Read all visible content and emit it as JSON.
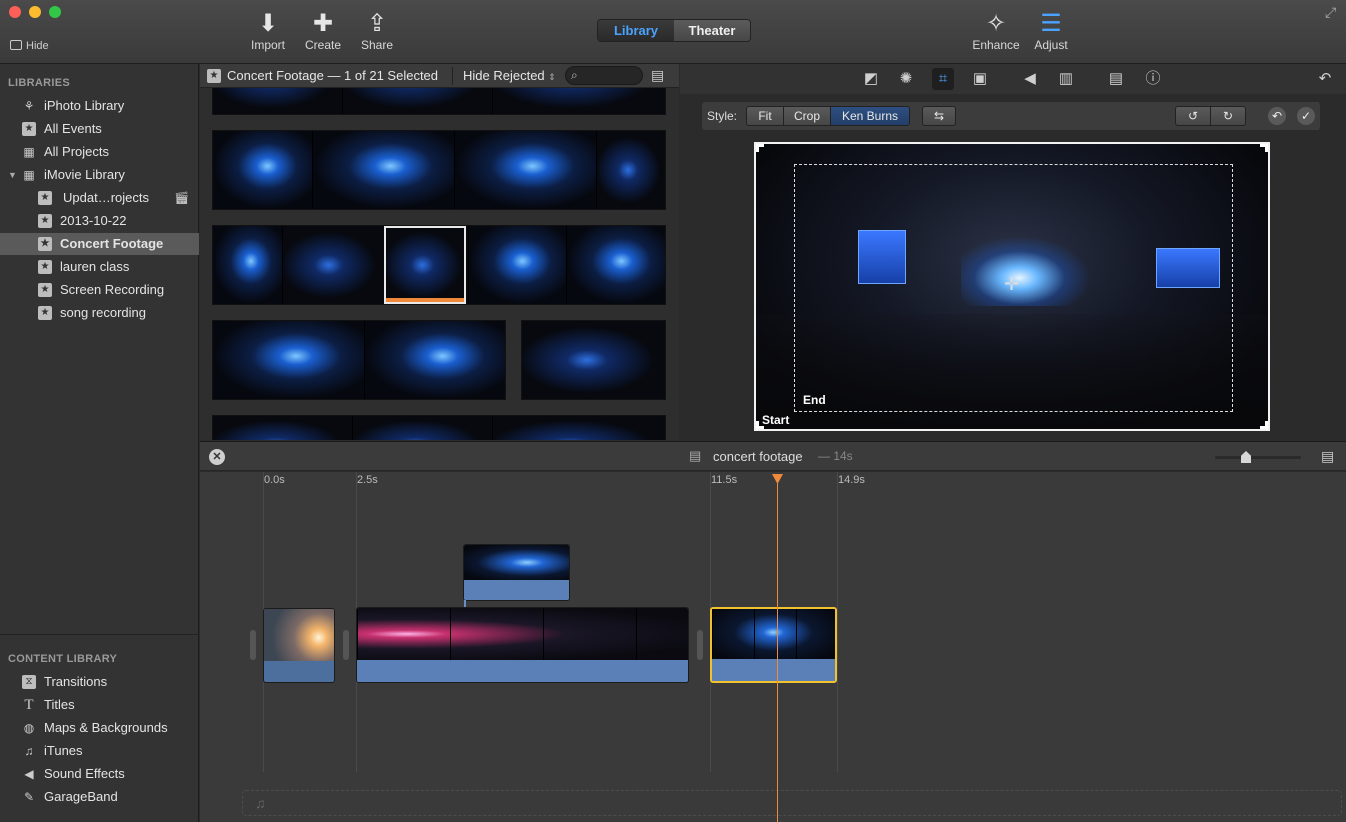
{
  "toolbar": {
    "hide_label": "Hide",
    "import_label": "Import",
    "create_label": "Create",
    "share_label": "Share",
    "library_tab": "Library",
    "theater_tab": "Theater",
    "enhance_label": "Enhance",
    "adjust_label": "Adjust"
  },
  "sidebar": {
    "libraries_heading": "LIBRARIES",
    "items": [
      {
        "label": "iPhoto Library",
        "icon": "star-ribbon-icon"
      },
      {
        "label": "All Events",
        "icon": "star-icon"
      },
      {
        "label": "All Projects",
        "icon": "grid-icon"
      },
      {
        "label": "iMovie Library",
        "icon": "grid-icon"
      },
      {
        "label": "Updat…rojects",
        "icon": "star-icon"
      },
      {
        "label": "2013-10-22",
        "icon": "star-icon"
      },
      {
        "label": "Concert Footage",
        "icon": "star-icon"
      },
      {
        "label": "lauren class",
        "icon": "star-icon"
      },
      {
        "label": "Screen Recording",
        "icon": "star-icon"
      },
      {
        "label": "song recording",
        "icon": "star-icon"
      }
    ],
    "content_heading": "CONTENT LIBRARY",
    "content_items": [
      {
        "label": "Transitions",
        "icon": "transitions-icon"
      },
      {
        "label": "Titles",
        "icon": "titles-icon"
      },
      {
        "label": "Maps & Backgrounds",
        "icon": "globe-icon"
      },
      {
        "label": "iTunes",
        "icon": "music-note-icon"
      },
      {
        "label": "Sound Effects",
        "icon": "speaker-icon"
      },
      {
        "label": "GarageBand",
        "icon": "guitar-icon"
      }
    ]
  },
  "browser": {
    "title": "Concert Footage — 1 of 21 Selected",
    "filter": "Hide Rejected"
  },
  "viewer": {
    "style_label": "Style:",
    "style_options": [
      "Fit",
      "Crop",
      "Ken Burns"
    ],
    "selected_style": "Ken Burns",
    "start_label": "Start",
    "end_label": "End"
  },
  "timeline": {
    "project_name": "concert footage",
    "duration": "— 14s",
    "ticks": [
      "0.0s",
      "2.5s",
      "11.5s",
      "14.9s"
    ]
  },
  "colors": {
    "accent_blue": "#4aa3ff",
    "playhead": "#f08a3a",
    "selection_yellow": "#f2c12e"
  }
}
